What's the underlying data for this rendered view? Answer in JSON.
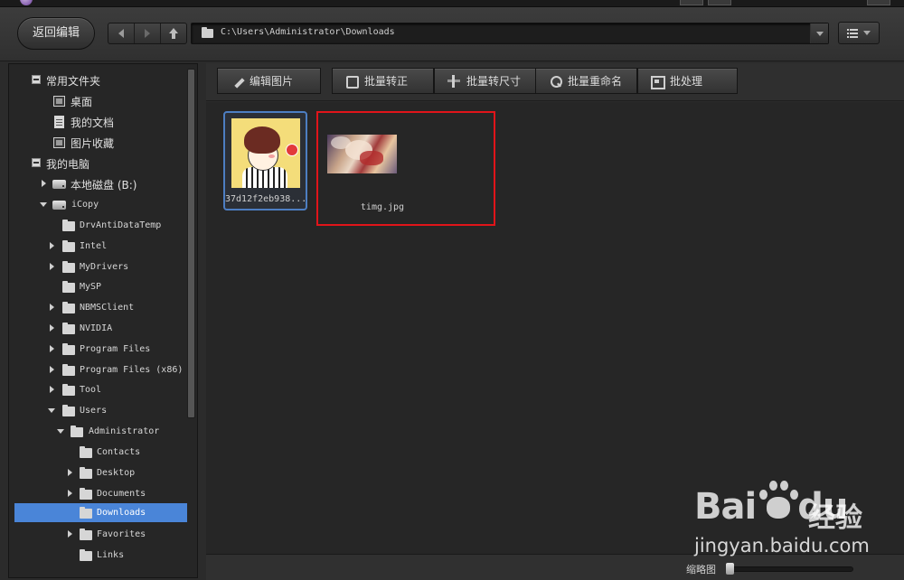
{
  "toolbar": {
    "back_label": "返回编辑",
    "path": "C:\\Users\\Administrator\\Downloads"
  },
  "sidebar": {
    "items": [
      {
        "label": "常用文件夹"
      },
      {
        "label": "桌面"
      },
      {
        "label": "我的文档"
      },
      {
        "label": "图片收藏"
      },
      {
        "label": "我的电脑"
      },
      {
        "label": "本地磁盘 (B:)"
      },
      {
        "label": "iCopy"
      },
      {
        "label": "DrvAntiDataTemp"
      },
      {
        "label": "Intel"
      },
      {
        "label": "MyDrivers"
      },
      {
        "label": "MySP"
      },
      {
        "label": "NBMSClient"
      },
      {
        "label": "NVIDIA"
      },
      {
        "label": "Program Files"
      },
      {
        "label": "Program Files (x86)"
      },
      {
        "label": "Tool"
      },
      {
        "label": "Users"
      },
      {
        "label": "Administrator"
      },
      {
        "label": "Contacts"
      },
      {
        "label": "Desktop"
      },
      {
        "label": "Documents"
      },
      {
        "label": "Downloads"
      },
      {
        "label": "Favorites"
      },
      {
        "label": "Links"
      }
    ]
  },
  "actions": {
    "edit": "编辑图片",
    "convert": "批量转正",
    "resize": "批量转尺寸",
    "rename": "批量重命名",
    "batch": "批处理"
  },
  "files": [
    {
      "name": "37d12f2eb938..."
    },
    {
      "name": "timg.jpg"
    }
  ],
  "status": {
    "zoom_label": "缩略图"
  },
  "watermark": {
    "brand": "Bai",
    "brand2": "du",
    "cn": "经验",
    "url": "jingyan.baidu.com"
  },
  "colors": {
    "selection": "#4a85d8",
    "highlight_box": "#e0141a",
    "thumb_border": "#4d7ec2"
  }
}
